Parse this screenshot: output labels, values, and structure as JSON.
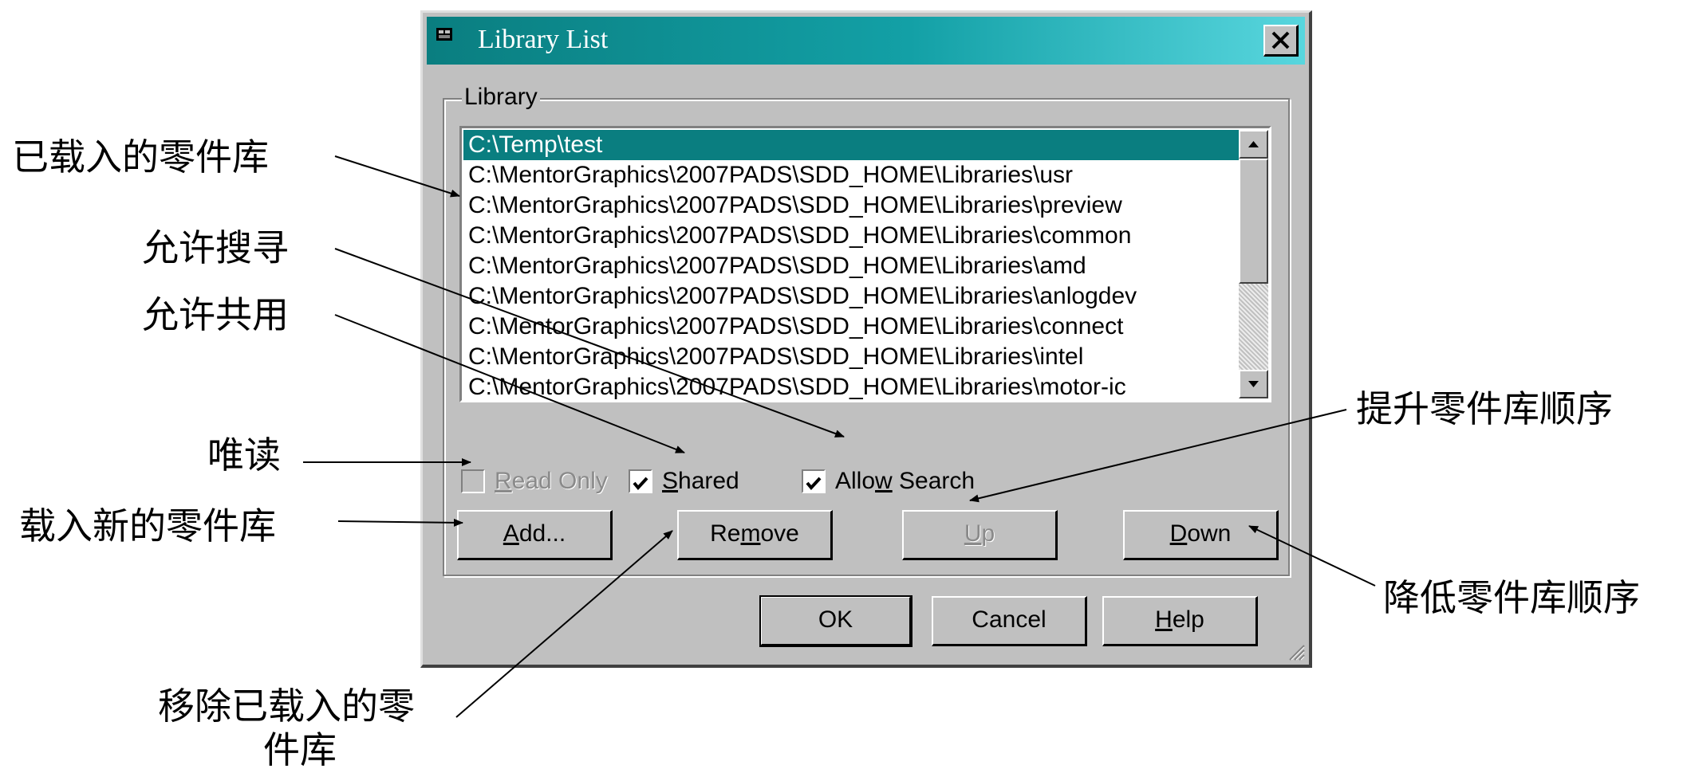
{
  "dialog": {
    "title": "Library List",
    "close_label": "×",
    "group_label": "Library",
    "libraries": [
      "C:\\Temp\\test",
      "C:\\MentorGraphics\\2007PADS\\SDD_HOME\\Libraries\\usr",
      "C:\\MentorGraphics\\2007PADS\\SDD_HOME\\Libraries\\preview",
      "C:\\MentorGraphics\\2007PADS\\SDD_HOME\\Libraries\\common",
      "C:\\MentorGraphics\\2007PADS\\SDD_HOME\\Libraries\\amd",
      "C:\\MentorGraphics\\2007PADS\\SDD_HOME\\Libraries\\anlogdev",
      "C:\\MentorGraphics\\2007PADS\\SDD_HOME\\Libraries\\connect",
      "C:\\MentorGraphics\\2007PADS\\SDD_HOME\\Libraries\\intel",
      "C:\\MentorGraphics\\2007PADS\\SDD_HOME\\Libraries\\motor-ic"
    ],
    "selected_index": 0,
    "checkboxes": {
      "read_only": {
        "label_mnemonic": "R",
        "label_rest": "ead Only",
        "checked": false,
        "enabled": false
      },
      "shared": {
        "label_mnemonic": "S",
        "label_rest": "hared",
        "checked": true,
        "enabled": true
      },
      "allow_search": {
        "label_pre": "Allo",
        "label_mnemonic": "w",
        "label_rest": " Search",
        "checked": true,
        "enabled": true
      }
    },
    "buttons": {
      "add": {
        "mnemonic": "A",
        "rest": "dd..."
      },
      "remove": {
        "pre": "Re",
        "mnemonic": "m",
        "rest": "ove"
      },
      "up": {
        "mnemonic": "U",
        "rest": "p"
      },
      "down": {
        "mnemonic": "D",
        "rest": "own"
      },
      "ok": {
        "label": "OK"
      },
      "cancel": {
        "label": "Cancel"
      },
      "help": {
        "mnemonic": "H",
        "rest": "elp"
      }
    }
  },
  "annotations": {
    "loaded_libraries": "已载入的零件库",
    "allow_search": "允许搜寻",
    "allow_shared": "允许共用",
    "read_only": "唯读",
    "add_new": "载入新的零件库",
    "move_up": "提升零件库顺序",
    "move_down": "降低零件库顺序",
    "remove_line1": "移除已载入的零",
    "remove_line2": "件库"
  },
  "colors": {
    "title_gradient_start": "#0a7e80",
    "title_gradient_end": "#58d6de",
    "dialog_face": "#c0c0c0",
    "selection": "#0a7e80"
  }
}
